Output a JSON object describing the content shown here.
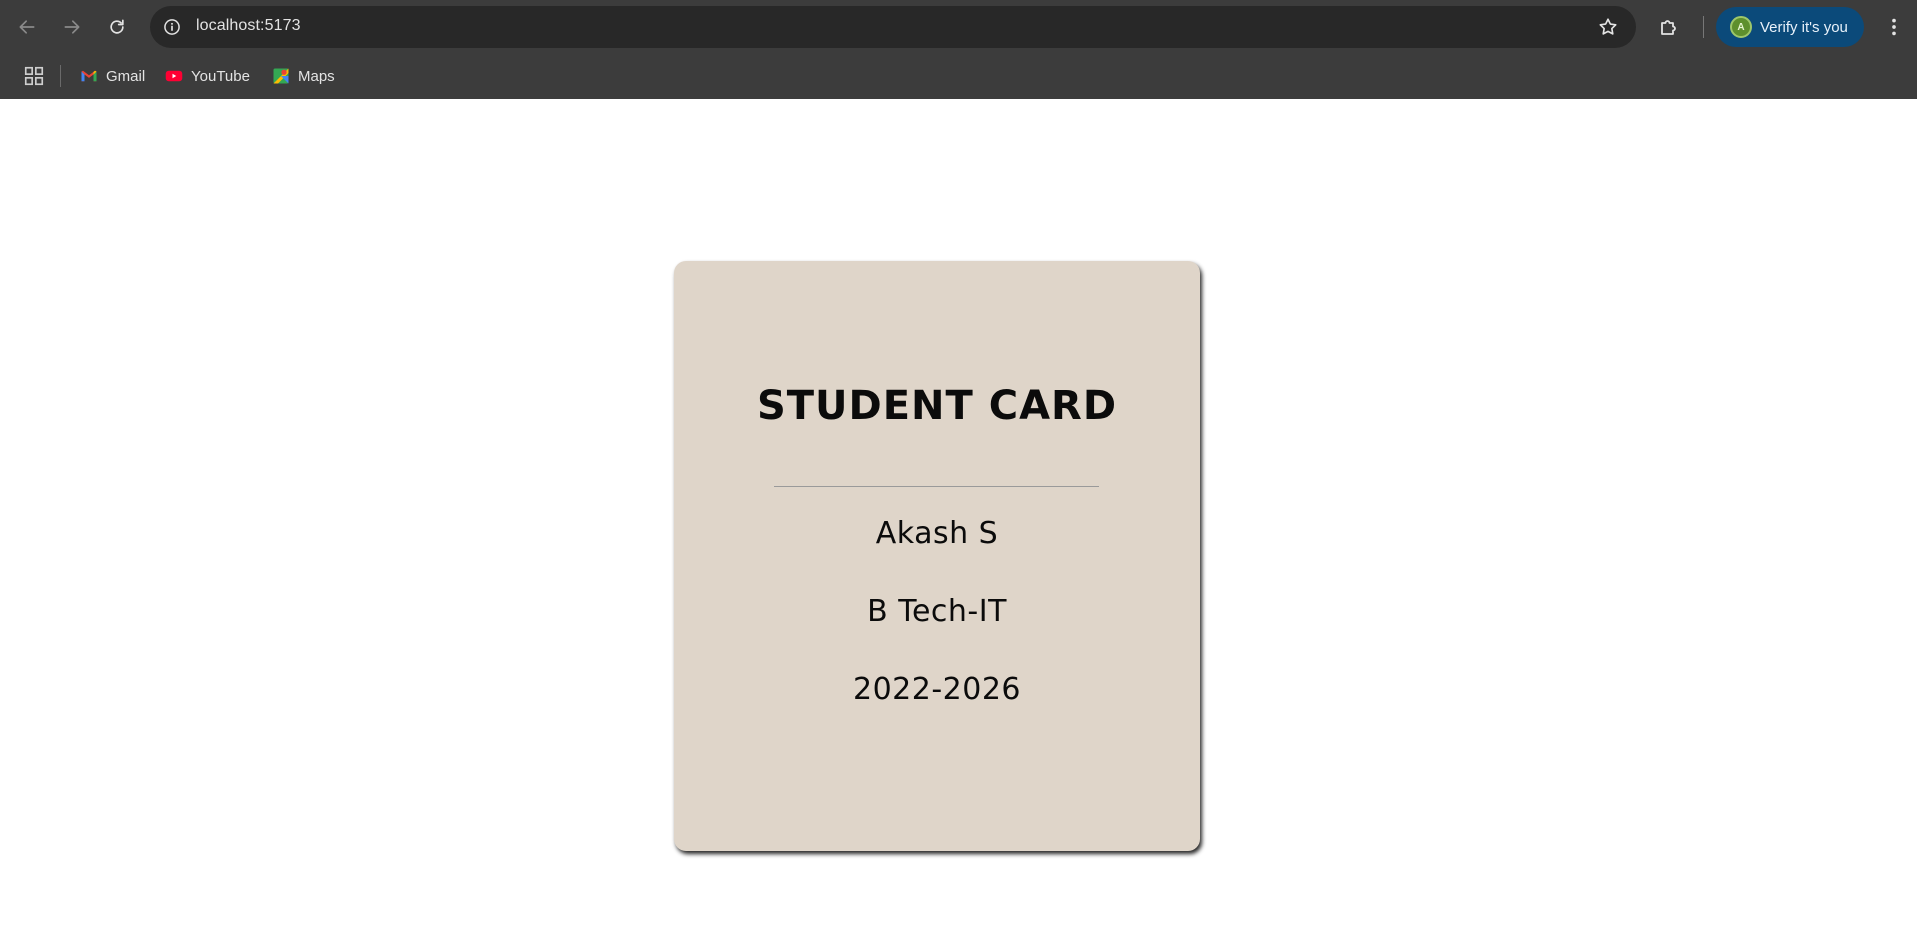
{
  "browser": {
    "url": "localhost:5173",
    "profile_button": {
      "avatar_letter": "A",
      "label": "Verify it's you"
    },
    "bookmarks": [
      {
        "label": "Gmail",
        "icon": "gmail-icon"
      },
      {
        "label": "YouTube",
        "icon": "youtube-icon"
      },
      {
        "label": "Maps",
        "icon": "maps-icon"
      }
    ]
  },
  "card": {
    "title": "STUDENT CARD",
    "name": "Akash S",
    "program": "B Tech-IT",
    "batch": "2022-2026",
    "background_color": "#dfd5c9"
  }
}
